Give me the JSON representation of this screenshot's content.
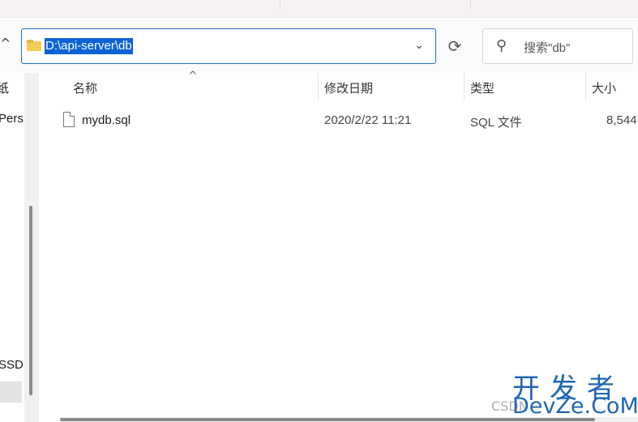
{
  "address": {
    "path": "D:\\api-server\\db"
  },
  "search": {
    "placeholder": "搜索\"db\""
  },
  "nav": {
    "items": [
      {
        "label": "纸"
      },
      {
        "label": "Pers"
      },
      {
        "label": "SSD"
      }
    ]
  },
  "columns": [
    {
      "label": "名称"
    },
    {
      "label": "修改日期"
    },
    {
      "label": "类型"
    },
    {
      "label": "大小"
    }
  ],
  "files": [
    {
      "name": "mydb.sql",
      "modified": "2020/2/22 11:21",
      "type": "SQL 文件",
      "size": "8,544"
    }
  ],
  "watermark": {
    "cn": "开发者",
    "en": "DevZe.CoM",
    "csdn": "CSDN"
  },
  "icons": [
    "up-caret-icon",
    "folder-icon",
    "chevron-down-icon",
    "refresh-icon",
    "search-icon",
    "sort-caret-icon",
    "file-icon"
  ]
}
